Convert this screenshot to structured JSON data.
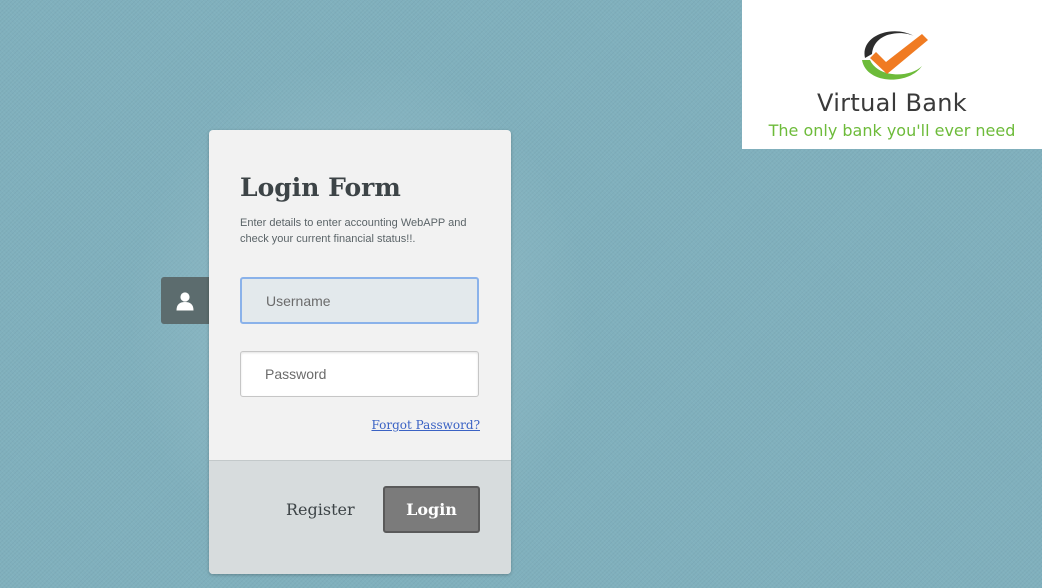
{
  "brand": {
    "name": "Virtual Bank",
    "tagline": "The only bank you'll ever need",
    "logo_icon": "checkmark-swoosh-logo",
    "colors": {
      "checkmark": "#f07b22",
      "swoosh_dark": "#2d2d2d",
      "swoosh_green": "#6dbb3a",
      "tagline": "#6dbb3a"
    }
  },
  "side_tab": {
    "icon": "user-icon"
  },
  "login_form": {
    "title": "Login Form",
    "subtitle": "Enter details to enter accounting WebAPP and check your current financial status!!.",
    "username": {
      "placeholder": "Username",
      "value": ""
    },
    "password": {
      "placeholder": "Password",
      "value": ""
    },
    "forgot_password_label": "Forgot Password?",
    "register_label": "Register",
    "login_label": "Login"
  },
  "colors": {
    "background": "#80b0bd",
    "card": "#f2f2f2",
    "footer": "#d7dcdd",
    "focus_border": "#8ab2ea",
    "link": "#3a62c4",
    "login_button": "#7b7b7b"
  }
}
